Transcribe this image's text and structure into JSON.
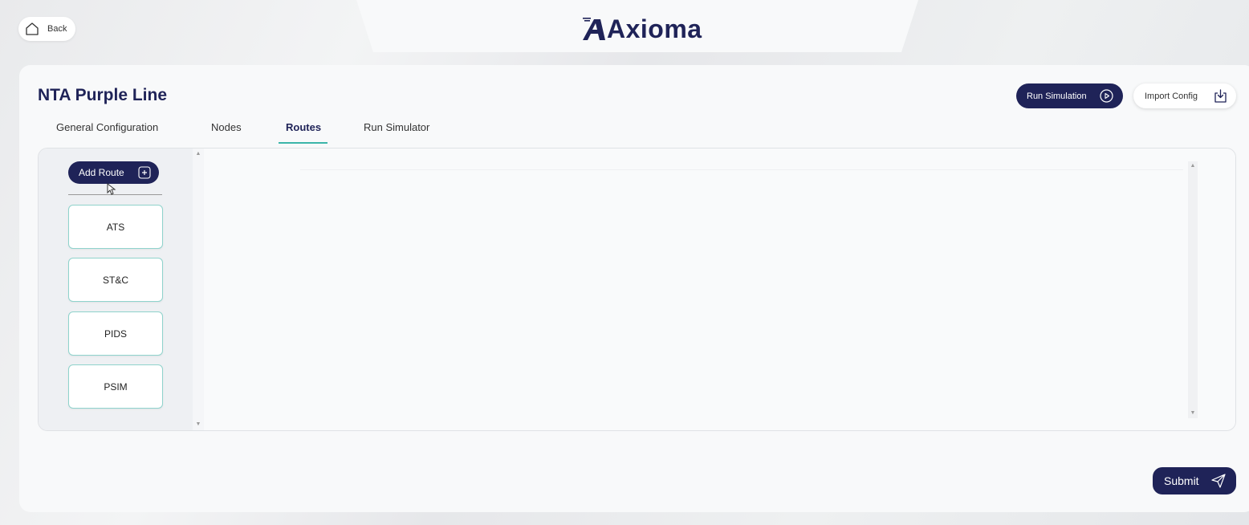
{
  "header": {
    "back_label": "Back",
    "logo_text": "Axioma"
  },
  "project": {
    "title": "NTA Purple Line"
  },
  "actions": {
    "run_simulation": "Run Simulation",
    "import_config": "Import Config",
    "submit": "Submit"
  },
  "tabs": [
    {
      "label": "General Configuration",
      "active": false
    },
    {
      "label": "Nodes",
      "active": false
    },
    {
      "label": "Routes",
      "active": true
    },
    {
      "label": "Run Simulator",
      "active": false
    }
  ],
  "routes": {
    "add_label": "Add Route",
    "items": [
      "ATS",
      "ST&C",
      "PIDS",
      "PSIM"
    ]
  },
  "colors": {
    "primary": "#1f2358",
    "accent": "#3bb5a9"
  }
}
